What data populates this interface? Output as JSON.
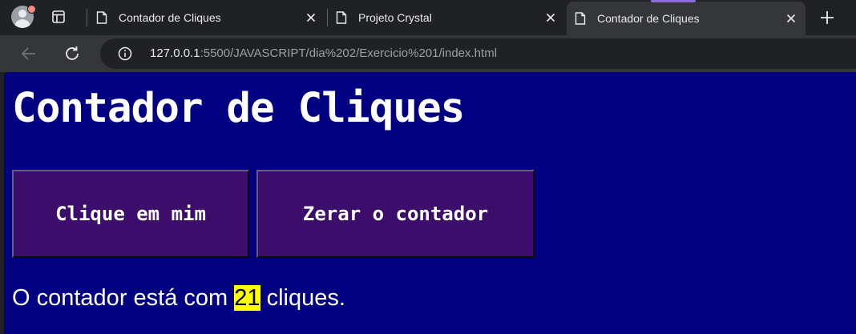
{
  "browser": {
    "tabs": [
      {
        "title": "Contador de Cliques",
        "active": false
      },
      {
        "title": "Projeto Crystal",
        "active": false
      },
      {
        "title": "Contador de Cliques",
        "active": true
      }
    ],
    "address": {
      "host": "127.0.0.1",
      "path": ":5500/JAVASCRIPT/dia%202/Exercicio%201/index.html"
    },
    "icons": {
      "profile": "profile-avatar-icon",
      "tab_actions": "tab-actions-icon",
      "page": "page-icon",
      "close": "close-icon",
      "new_tab": "plus-icon",
      "back": "back-arrow-icon",
      "reload": "reload-icon",
      "site_info": "info-icon"
    },
    "colors": {
      "chrome_bg": "#202124",
      "toolbar_bg": "#35363a",
      "text": "#e8eaed",
      "muted_text": "#9aa0a6",
      "profile_badge": "#f28b82"
    }
  },
  "page": {
    "title": "Contador de Cliques",
    "buttons": {
      "click": "Clique em mim",
      "reset": "Zerar o contador"
    },
    "status": {
      "prefix": "O contador está com ",
      "count": "21",
      "suffix": " cliques."
    },
    "colors": {
      "background": "#000080",
      "button_bg": "#3d0d6b",
      "highlight": "#ffff00",
      "text": "#ffffff"
    }
  }
}
